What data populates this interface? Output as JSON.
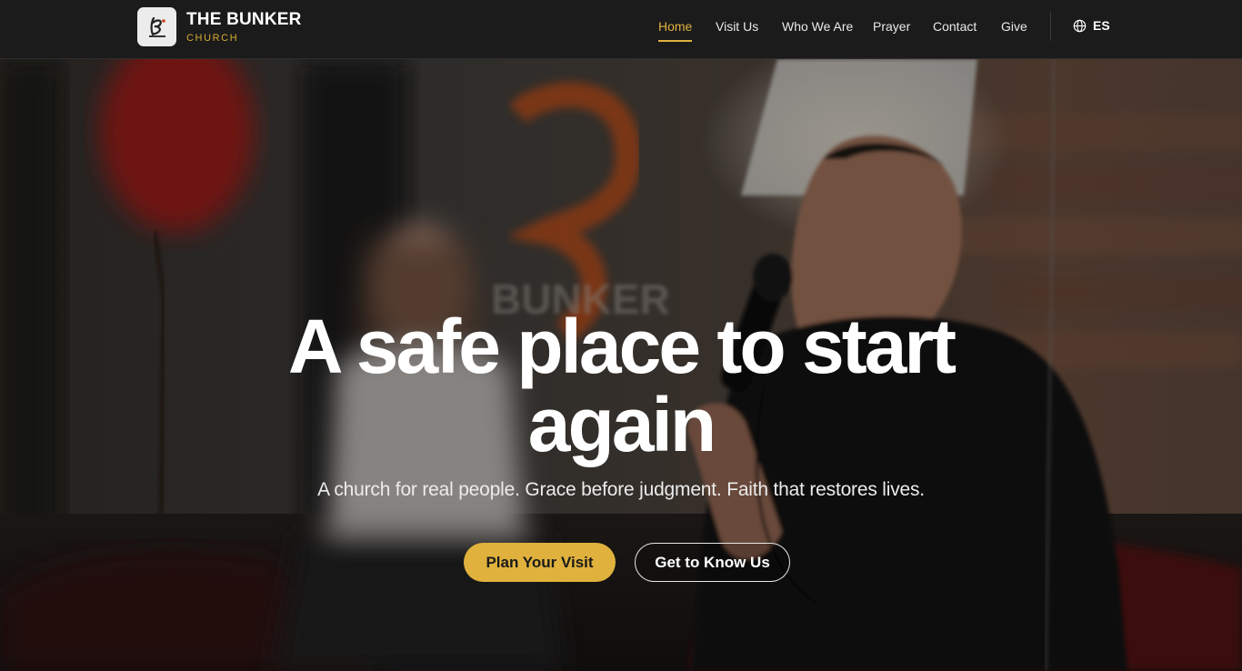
{
  "brand": {
    "name": "THE BUNKER",
    "subtitle": "CHURCH",
    "logo_icon": "bunker-b-logo-icon",
    "accent_color": "#e0b23d"
  },
  "nav": {
    "items": [
      {
        "label": "Home",
        "active": true
      },
      {
        "label": "Visit Us",
        "active": false
      },
      {
        "label": "Who We Are",
        "active": false
      },
      {
        "label": "Prayer",
        "active": false
      },
      {
        "label": "Contact",
        "active": false
      },
      {
        "label": "Give",
        "active": false
      }
    ],
    "language": {
      "icon": "globe-icon",
      "label": "ES"
    }
  },
  "hero": {
    "title": "A safe place to start again",
    "subtitle": "A church for real people. Grace before judgment. Faith that restores lives.",
    "primary_button": "Plan Your Visit",
    "secondary_button": "Get to Know Us"
  }
}
